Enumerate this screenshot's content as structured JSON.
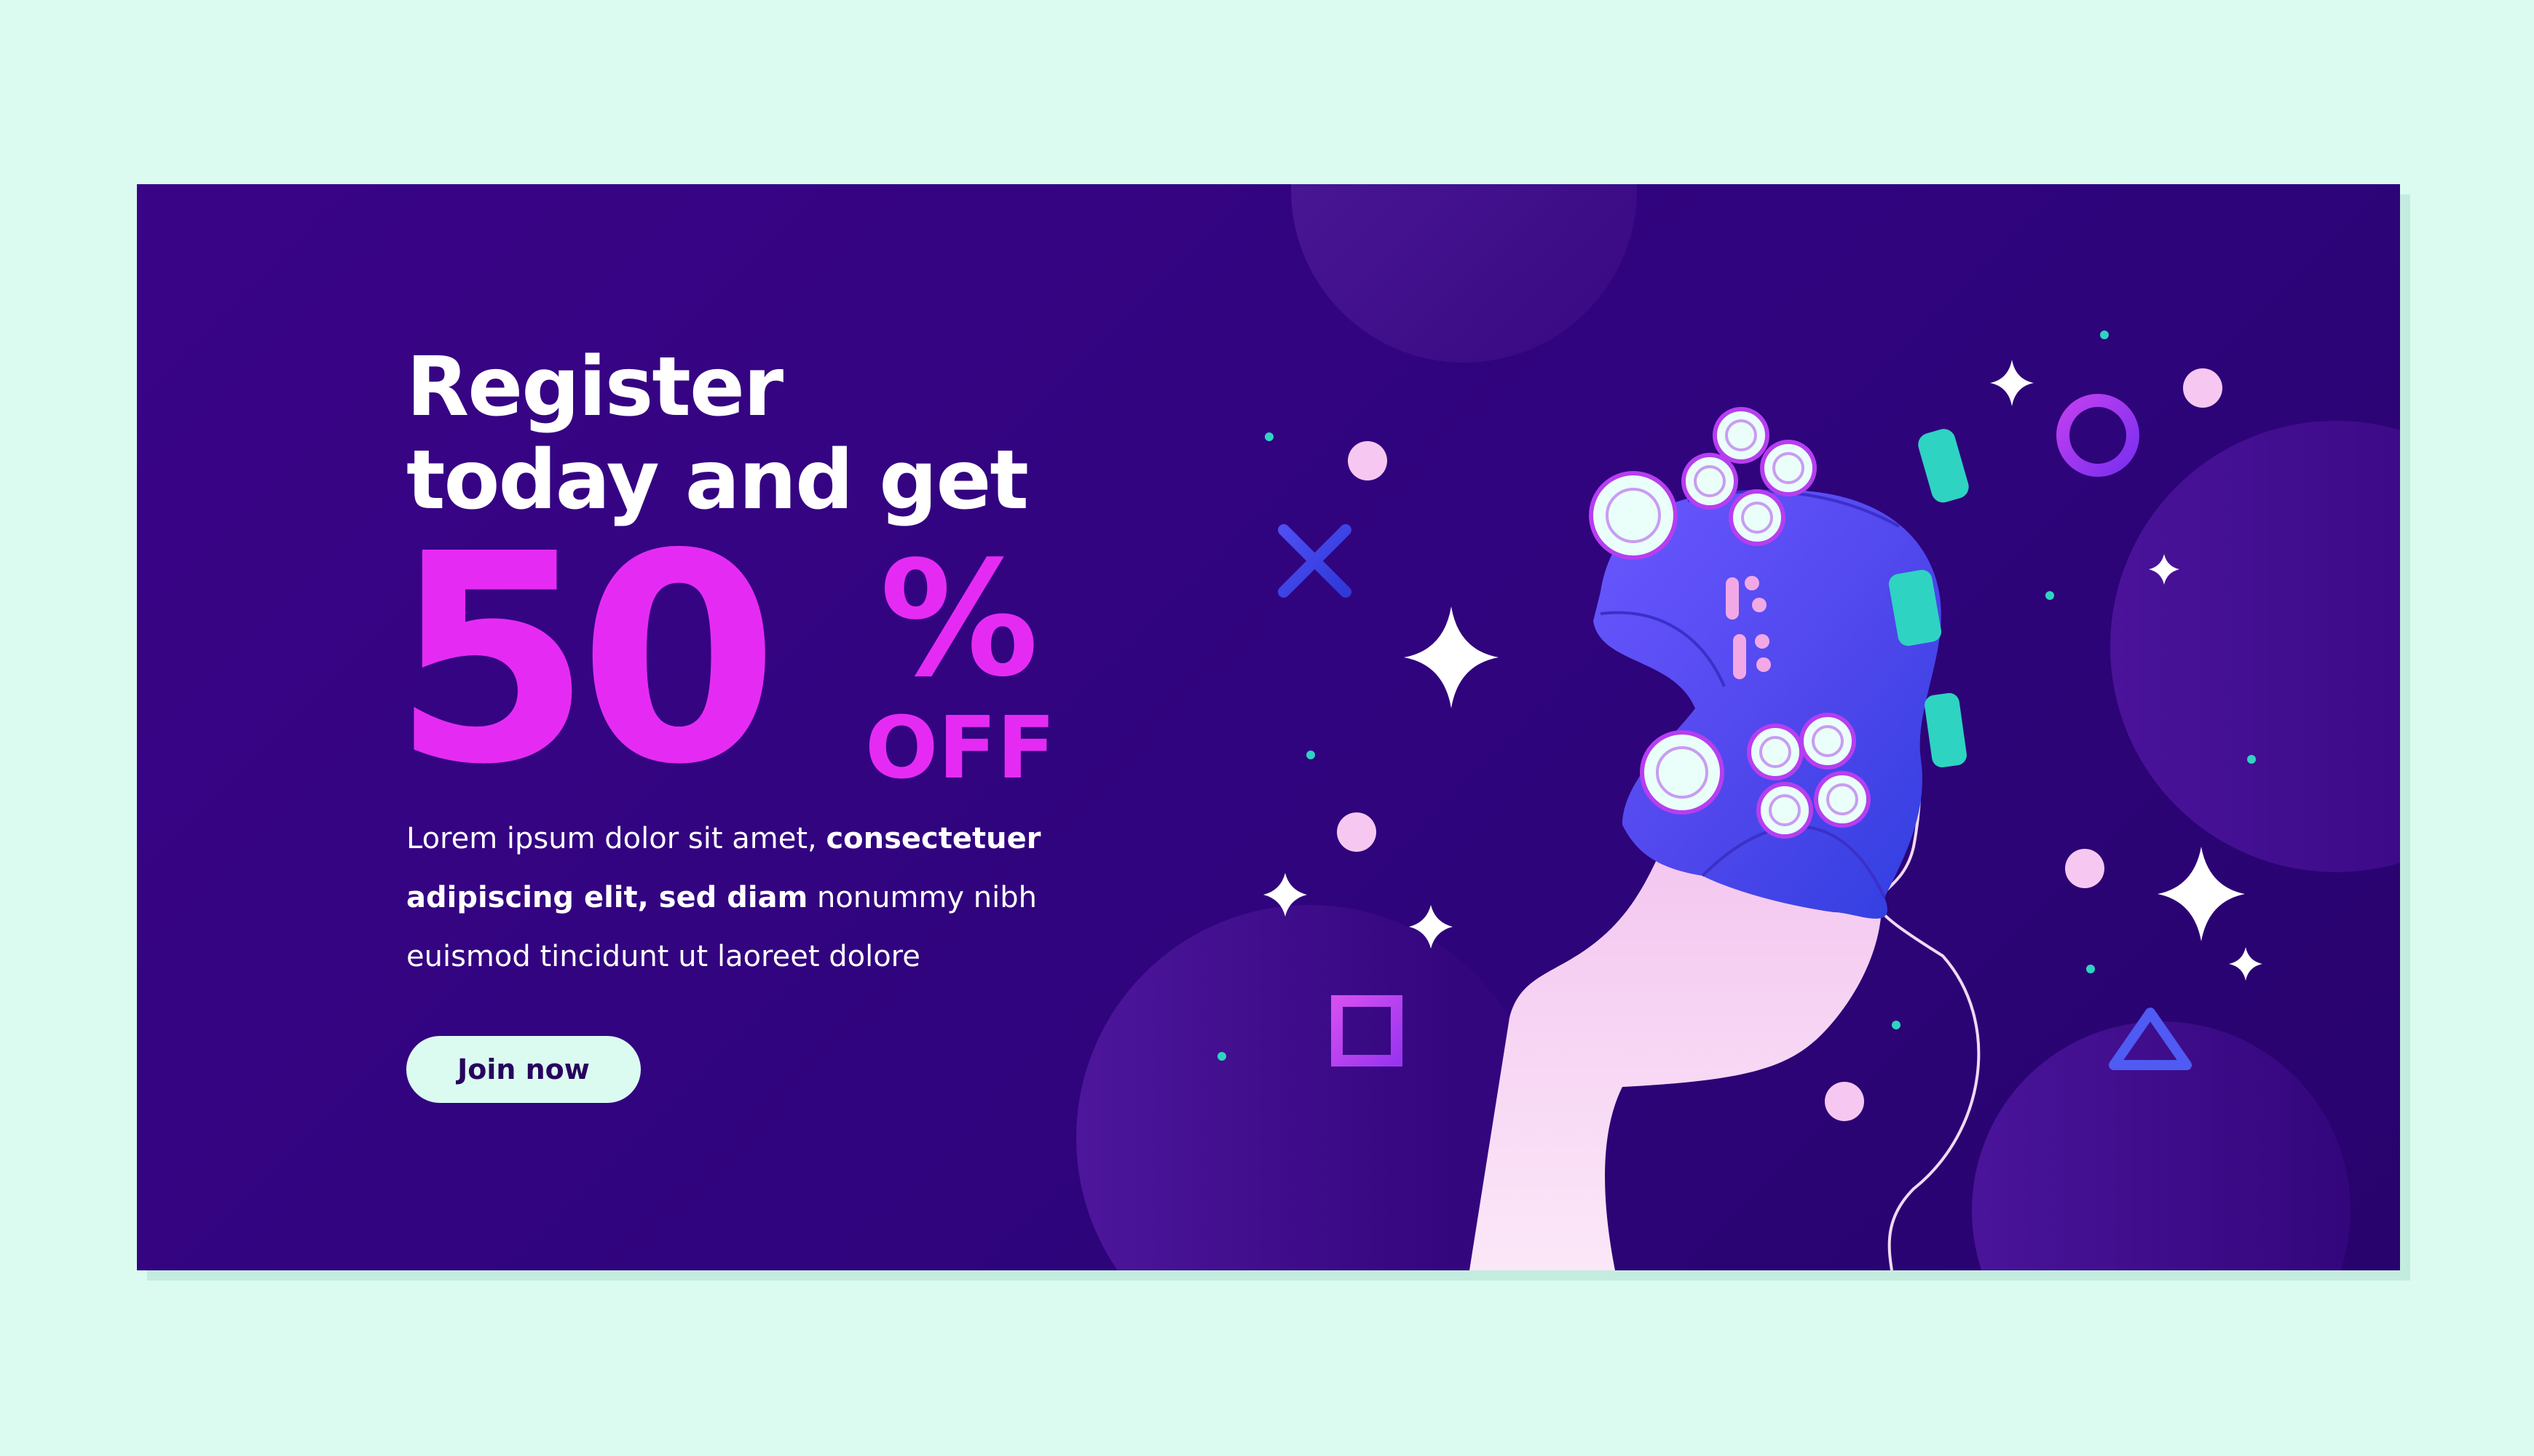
{
  "banner": {
    "headline_line1": "Register",
    "headline_line2": "today and get",
    "offer_number": "50",
    "offer_percent": "%",
    "offer_off": "OFF",
    "description_part1": "Lorem ipsum dolor sit amet, ",
    "description_bold": "consectetuer adipiscing elit, sed diam",
    "description_part2": " nonummy nibh euismod tincidunt ut laoreet dolore",
    "cta_label": "Join now"
  },
  "colors": {
    "page_background": "#dbfbf1",
    "banner_background": "#33057f",
    "accent_pink": "#e52bf3",
    "controller_blue": "#5b4cf0",
    "controller_teal": "#2fd3c2",
    "hand_pink": "#f2c6ef"
  },
  "icons": [
    "game-controller-illustration",
    "hand-illustration",
    "cross-symbol-icon",
    "circle-symbol-icon",
    "square-symbol-icon",
    "triangle-symbol-icon",
    "sparkle-star-icon",
    "dot-decoration"
  ]
}
